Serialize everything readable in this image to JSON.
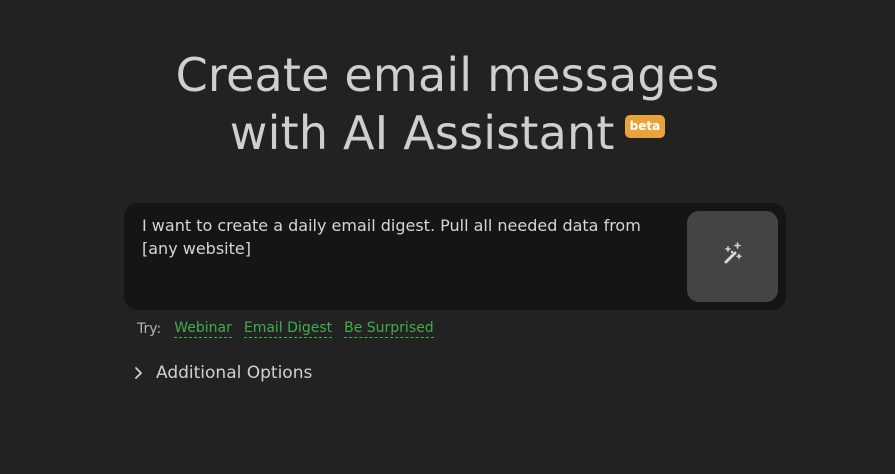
{
  "header": {
    "title_line1": "Create email messages",
    "title_line2": "with AI Assistant",
    "badge": "beta"
  },
  "prompt": {
    "value": "I want to create a daily email digest. Pull all needed data from [any website]"
  },
  "generate_button": {
    "icon": "magic-wand-icon"
  },
  "suggestions": {
    "label": "Try:",
    "items": [
      "Webinar",
      "Email Digest",
      "Be Surprised"
    ]
  },
  "additional_options": {
    "label": "Additional Options",
    "icon": "chevron-right-icon"
  },
  "colors": {
    "background": "#222222",
    "input_background": "#151515",
    "button_background": "#444444",
    "badge": "#e8a33a",
    "suggestion": "#3fae4a"
  }
}
